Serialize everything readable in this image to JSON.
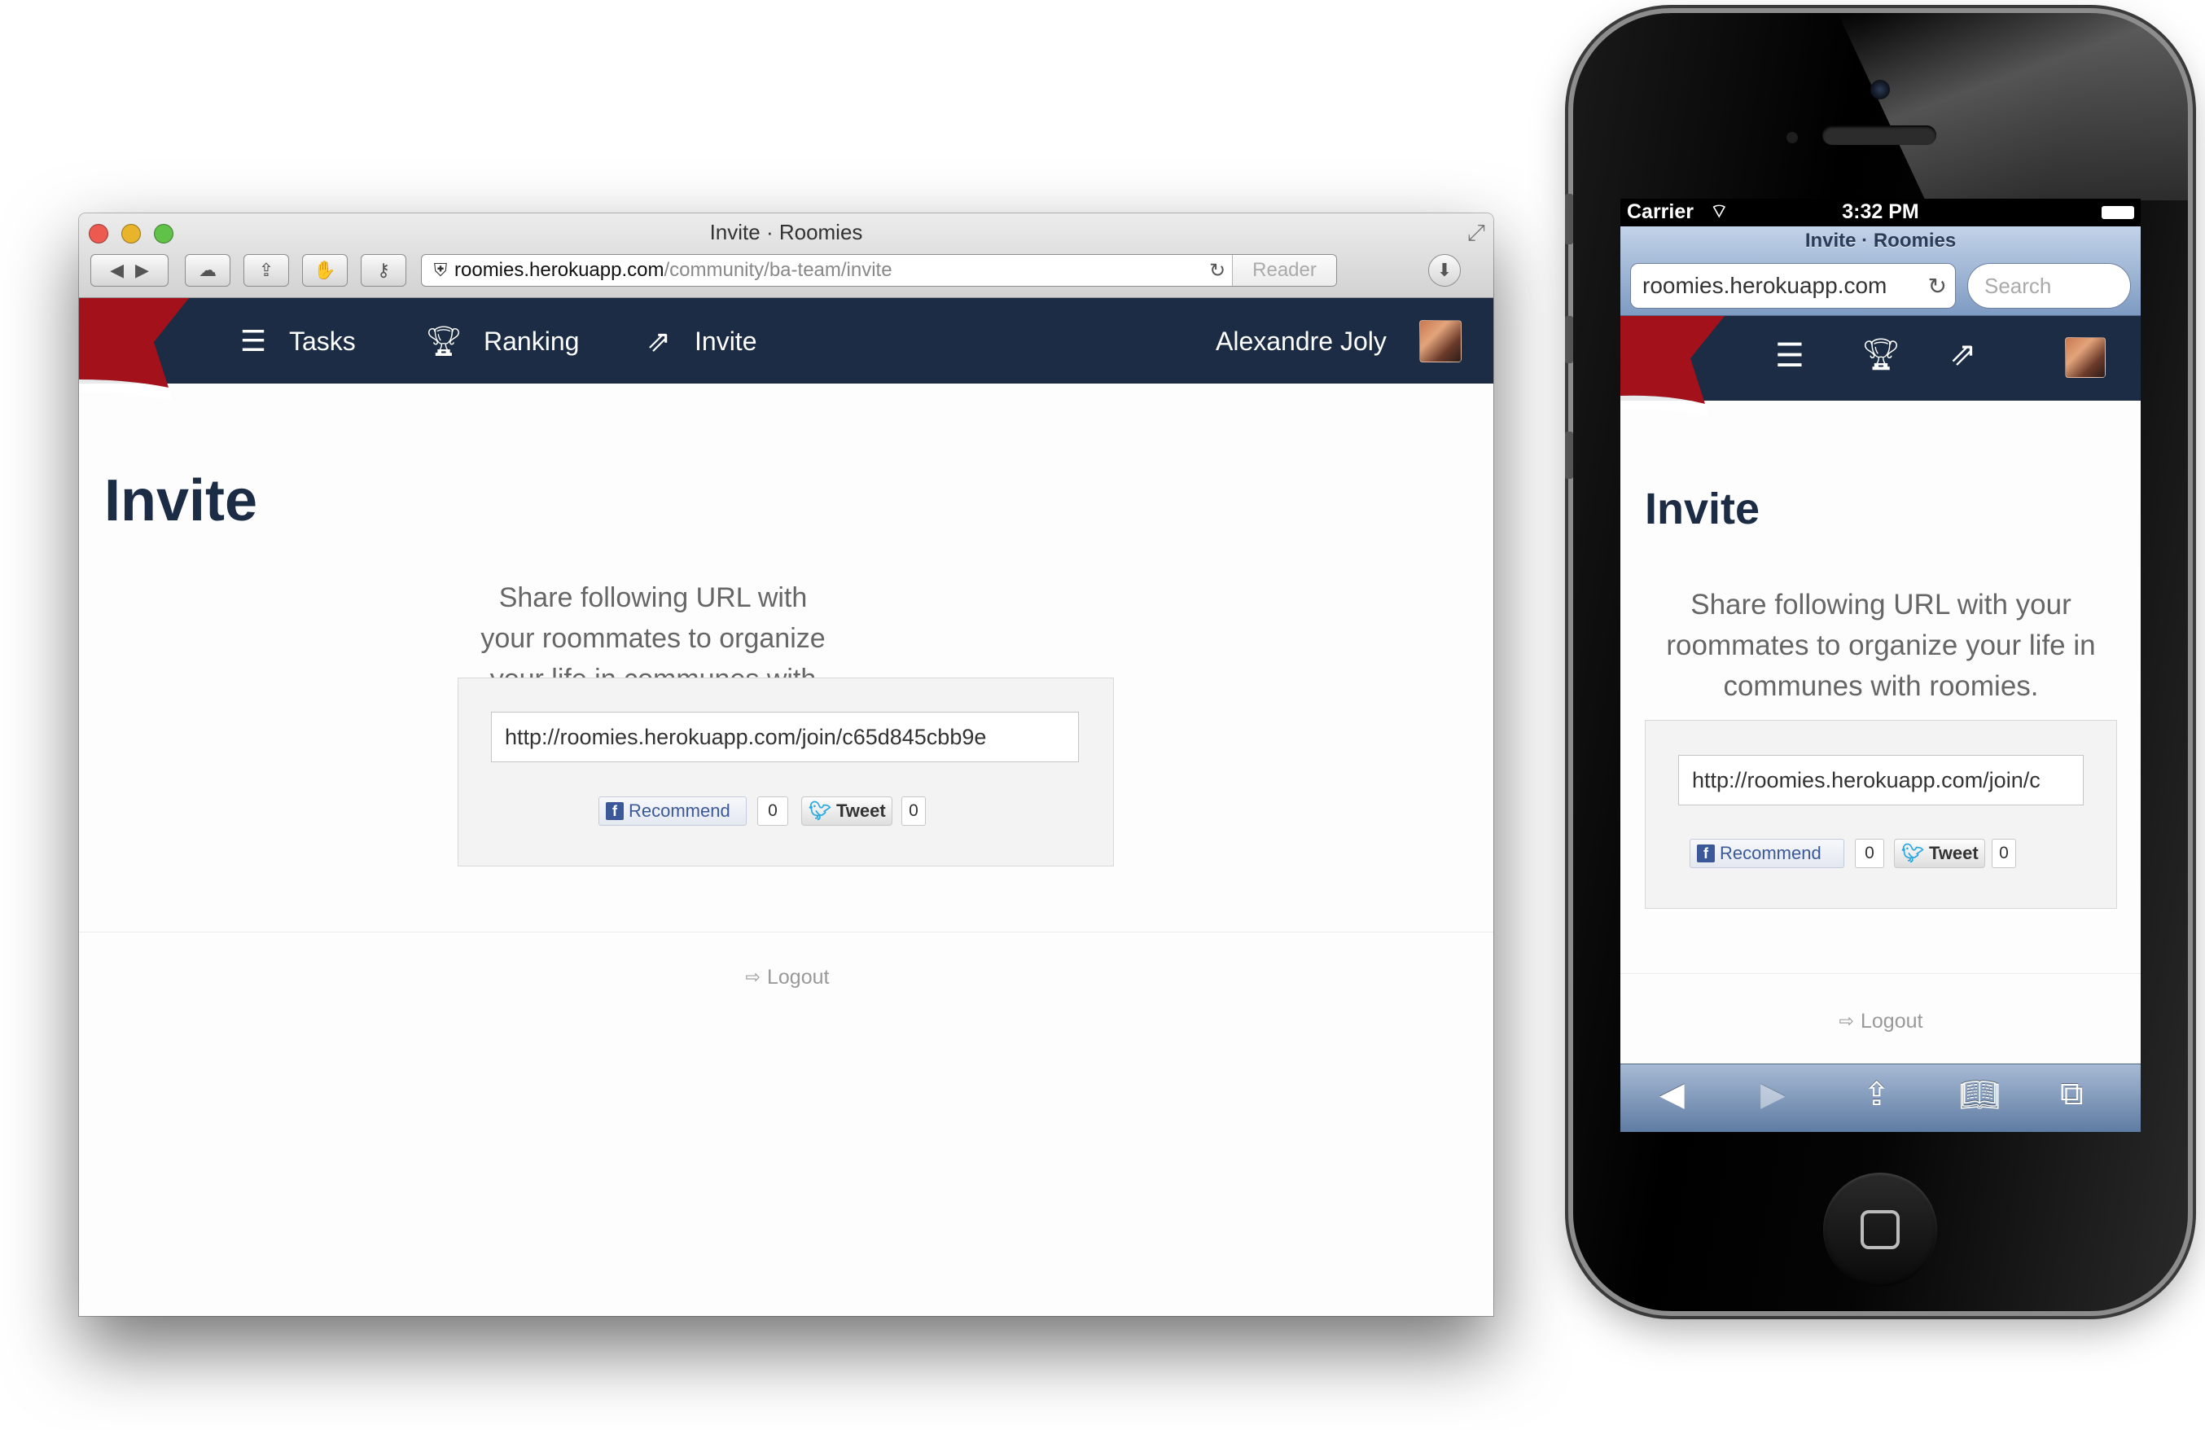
{
  "desktop": {
    "window_title": "Invite · Roomies",
    "address": {
      "host": "roomies.herokuapp.com",
      "path": "/community/ba-team/invite"
    },
    "reader_label": "Reader",
    "nav": {
      "tasks": "Tasks",
      "ranking": "Ranking",
      "invite": "Invite",
      "user_name": "Alexandre Joly"
    }
  },
  "page": {
    "heading": "Invite",
    "lead": "Share following URL with your roommates to organize your life in communes with roomies.",
    "invite_url": "http://roomies.herokuapp.com/join/c65d845cbb9e",
    "recommend_label": "Recommend",
    "recommend_count": "0",
    "tweet_label": "Tweet",
    "tweet_count": "0",
    "logout_label": "Logout"
  },
  "mobile": {
    "carrier": "Carrier",
    "time": "3:32 PM",
    "page_title": "Invite · Roomies",
    "address": "roomies.herokuapp.com",
    "search_placeholder": "Search",
    "invite_url_visible": "http://roomies.herokuapp.com/join/c"
  },
  "colors": {
    "navbar": "#1b2c44",
    "flag": "#a3121b",
    "heading": "#1b2c44",
    "facebook": "#3b5998",
    "twitter": "#2aa9e0"
  },
  "icons": [
    "tasks-icon",
    "trophy-icon",
    "share-icon",
    "logout-icon",
    "back-icon",
    "forward-icon",
    "bookmarks-icon",
    "tabs-icon",
    "reload-icon",
    "wifi-icon",
    "battery-icon"
  ]
}
